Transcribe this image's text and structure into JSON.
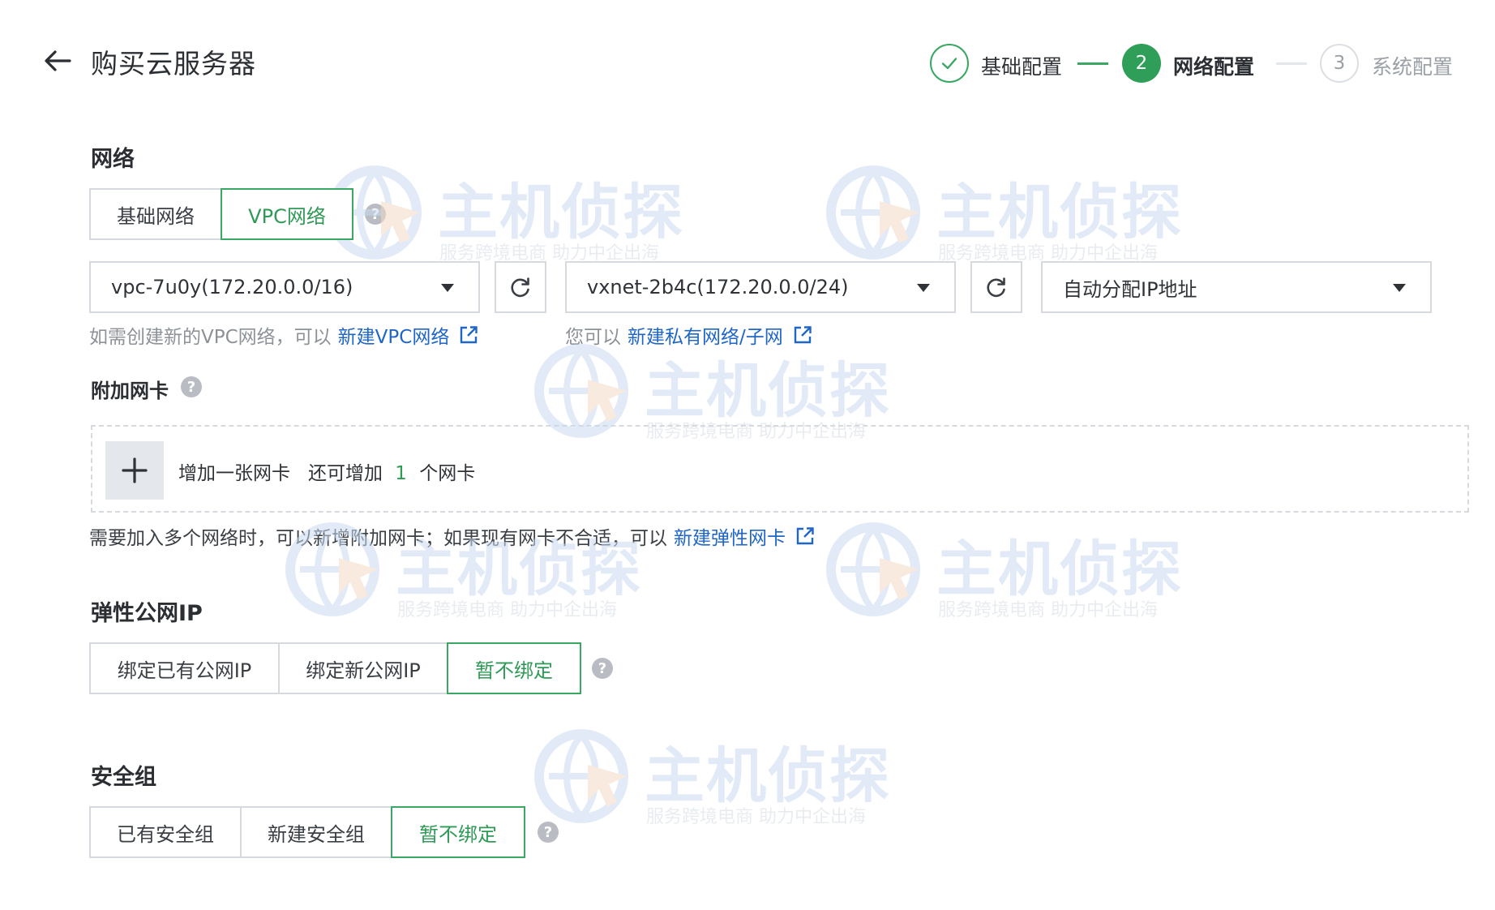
{
  "header": {
    "title": "购买云服务器",
    "steps": [
      {
        "number": "1",
        "label": "基础配置",
        "state": "done"
      },
      {
        "number": "2",
        "label": "网络配置",
        "state": "active"
      },
      {
        "number": "3",
        "label": "系统配置",
        "state": "pending"
      }
    ]
  },
  "network": {
    "title": "网络",
    "type_options": [
      "基础网络",
      "VPC网络"
    ],
    "selected_type": "VPC网络",
    "vpc_select": {
      "value": "vpc-7u0y(172.20.0.0/16)"
    },
    "subnet_select": {
      "value": "vxnet-2b4c(172.20.0.0/24)"
    },
    "ip_select": {
      "value": "自动分配IP地址"
    },
    "vpc_hint": {
      "text": "如需创建新的VPC网络，可以",
      "link": "新建VPC网络"
    },
    "subnet_hint": {
      "text": "您可以",
      "link": "新建私有网络/子网"
    }
  },
  "nic": {
    "title": "附加网卡",
    "add_label": "增加一张网卡",
    "remaining_prefix": "还可增加",
    "remaining_count": "1",
    "remaining_suffix": "个网卡",
    "hint": {
      "text": "需要加入多个网络时，可以新增附加网卡；如果现有网卡不合适，可以",
      "link": "新建弹性网卡"
    }
  },
  "eip": {
    "title": "弹性公网IP",
    "options": [
      "绑定已有公网IP",
      "绑定新公网IP",
      "暂不绑定"
    ],
    "selected": "暂不绑定"
  },
  "security_group": {
    "title": "安全组",
    "options": [
      "已有安全组",
      "新建安全组",
      "暂不绑定"
    ],
    "selected": "暂不绑定"
  },
  "watermark": {
    "main": "主机侦探",
    "sub": "服务跨境电商 助力中企出海"
  },
  "colors": {
    "accent": "#3aa763",
    "link": "#1f66c7",
    "border": "#d6d9dd",
    "muted": "#8d9299"
  },
  "icons": {
    "back": "arrow-left-icon",
    "check": "check-icon",
    "refresh": "refresh-icon",
    "external": "external-link-icon",
    "help": "question-circle-icon",
    "add": "plus-icon",
    "caret": "caret-down-icon"
  }
}
